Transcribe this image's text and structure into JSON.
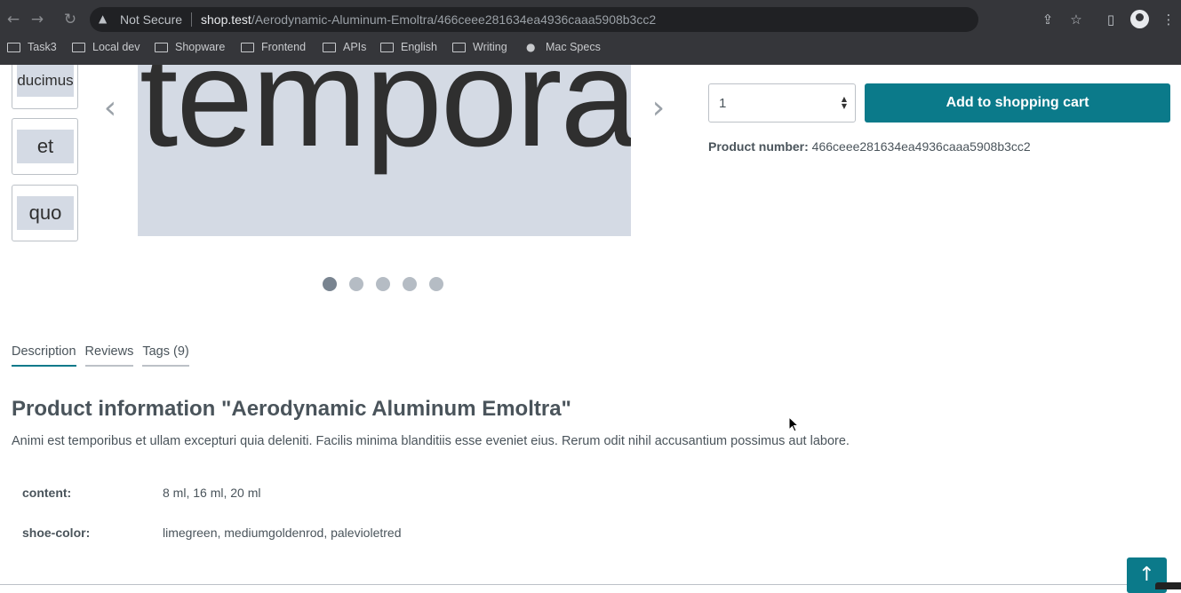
{
  "browser": {
    "security_label": "Not Secure",
    "url_host": "shop.test",
    "url_path": "/Aerodynamic-Aluminum-Emoltra/466ceee281634ea4936caaa5908b3cc2",
    "bookmarks": [
      "Task3",
      "Local dev",
      "Shopware",
      "Frontend",
      "APIs",
      "English",
      "Writing",
      "Mac Specs"
    ]
  },
  "gallery": {
    "thumbnails": [
      "ducimus",
      "et",
      "quo"
    ],
    "main_word": "tempora",
    "slide_count": 5,
    "active_slide": 1
  },
  "buy": {
    "quantity": "1",
    "add_to_cart_label": "Add to shopping cart",
    "product_number_label": "Product number:",
    "product_number": "466ceee281634ea4936caaa5908b3cc2"
  },
  "tabs": [
    "Description",
    "Reviews",
    "Tags (9)"
  ],
  "description": {
    "title": "Product information \"Aerodynamic Aluminum Emoltra\"",
    "text": "Animi est temporibus et ullam excepturi quia deleniti. Facilis minima blanditiis esse eveniet eius. Rerum odit nihil accusantium possimus aut labore.",
    "properties": [
      {
        "label": "content:",
        "value": "8 ml, 16 ml, 20 ml"
      },
      {
        "label": "shoe-color:",
        "value": "limegreen, mediumgoldenrod, palevioletred"
      }
    ]
  },
  "colors": {
    "accent": "#0b7a8a",
    "chrome": "#35363a"
  }
}
